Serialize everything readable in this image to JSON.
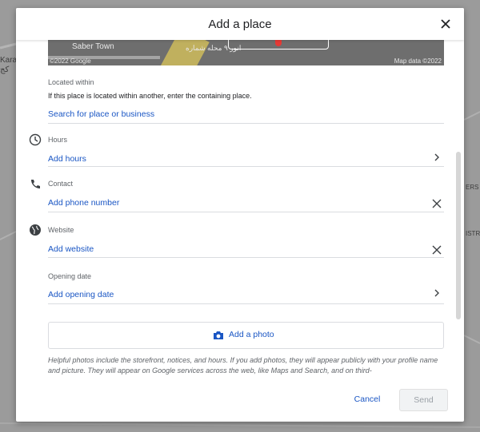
{
  "background_map": {
    "label_left": "Kara",
    "label_left2": "کج",
    "label_right": "ERS",
    "label_right2": "ISTRICT"
  },
  "dialog": {
    "title": "Add a place",
    "map_preview": {
      "place_name": "Saber Town",
      "arabic_label": "انور ۹ محله شماره",
      "copyright": "©2022 Google",
      "map_data": "Map data ©2022"
    },
    "located_within": {
      "label": "Located within",
      "description": "If this place is located within another, enter the containing place.",
      "input_placeholder": "Search for place or business"
    },
    "hours": {
      "label": "Hours",
      "action": "Add hours"
    },
    "contact": {
      "label": "Contact",
      "action": "Add phone number"
    },
    "website": {
      "label": "Website",
      "action": "Add website"
    },
    "opening_date": {
      "label": "Opening date",
      "action": "Add opening date"
    },
    "photo": {
      "label": "Add a photo"
    },
    "helper_text": "Helpful photos include the storefront, notices, and hours. If you add photos, they will appear publicly with your profile name and picture. They will appear on Google services across the web, like Maps and Search, and on third-",
    "buttons": {
      "cancel": "Cancel",
      "send": "Send"
    }
  },
  "colors": {
    "link": "#1a56c4",
    "text_secondary": "#5f6368",
    "divider": "#dadce0",
    "send_disabled_bg": "#f1f3f4"
  },
  "icons": {
    "close": "close-icon",
    "hours": "clock-icon",
    "contact": "phone-icon",
    "website": "globe-icon",
    "chevron": "chevron-right-icon",
    "clear": "clear-icon",
    "photo": "camera-icon"
  }
}
